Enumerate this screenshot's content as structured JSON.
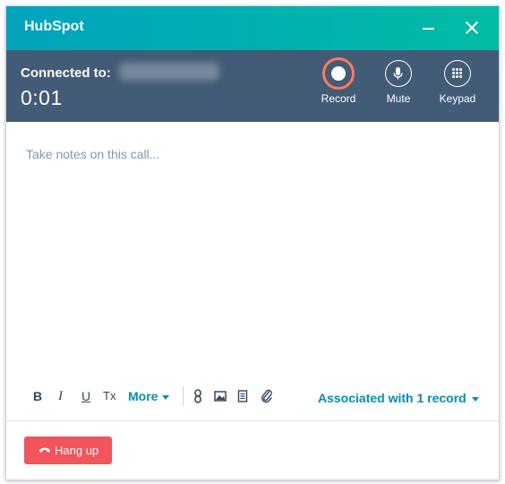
{
  "window": {
    "title": "HubSpot"
  },
  "call": {
    "connected_label": "Connected to:",
    "timer": "0:01",
    "controls": {
      "record": "Record",
      "mute": "Mute",
      "keypad": "Keypad"
    }
  },
  "notes": {
    "placeholder": "Take notes on this call..."
  },
  "toolbar": {
    "bold": "B",
    "italic": "I",
    "underline": "U",
    "clear": "Tx",
    "more": "More",
    "associated": "Associated with 1 record"
  },
  "footer": {
    "hangup": "Hang up"
  },
  "colors": {
    "header_start": "#00a4bd",
    "header_end": "#00bda5",
    "callbar": "#425b76",
    "record_ring": "#ff7a59",
    "link": "#0091ae",
    "hangup": "#f2545b"
  },
  "icons": [
    "minimize-icon",
    "close-icon",
    "record-icon",
    "microphone-icon",
    "keypad-icon",
    "link-icon",
    "image-icon",
    "document-icon",
    "paperclip-icon",
    "phone-icon"
  ]
}
